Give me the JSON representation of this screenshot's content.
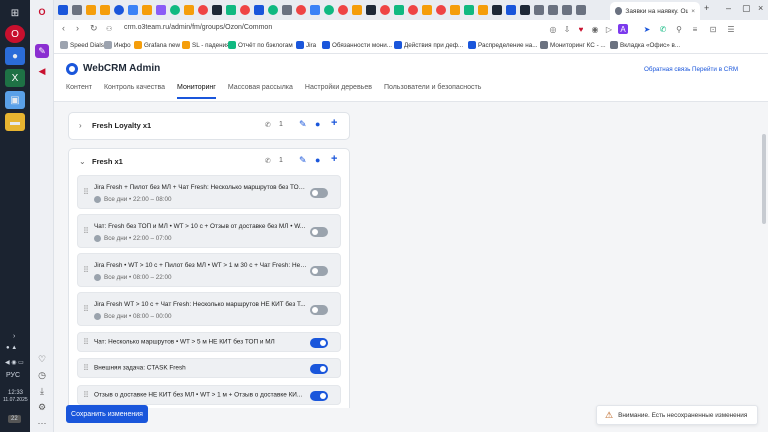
{
  "taskbar": {
    "time": "12:33",
    "date": "11.07.2025",
    "lang": "РУС",
    "notif_count": "22"
  },
  "browser": {
    "active_tab_title": "Заявки на наявку. Ошибк",
    "url": "crm.o3team.ru/admin/fm/groups/Ozon/Common",
    "bookmarks": [
      "Speed Dials",
      "Инфо",
      "Grafana new",
      "SL - падения",
      "Отчёт по бэклогам",
      "Jira",
      "Обязанности мони...",
      "Действия при деф...",
      "Распределение на...",
      "Мониторинг КС - ...",
      "Вкладка «Офис» в..."
    ]
  },
  "header": {
    "brand": "WebCRM Admin",
    "feedback_link": "Обратная связь",
    "crm_link": "Перейти в CRM"
  },
  "nav": [
    "Контент",
    "Контроль качества",
    "Мониторинг",
    "Массовая рассылка",
    "Настройки деревьев",
    "Пользователи и безопасность"
  ],
  "groups": [
    {
      "title": "Fresh Loyalty x1",
      "count": "1"
    },
    {
      "title": "Fresh x1",
      "count": "1"
    }
  ],
  "rules": [
    {
      "title": "Jira Fresh + Пилот без МЛ + Чат Fresh: Несколько маршрутов без ТОП...",
      "schedule": "Все дни • 22:00 – 08:00",
      "enabled": false
    },
    {
      "title": "Чат: Fresh без ТОП и МЛ • WT > 10 с + Отзыв от доставке без МЛ • W...",
      "schedule": "Все дни • 22:00 – 07:00",
      "enabled": false
    },
    {
      "title": "Jira Fresh • WT > 10 с + Пилот без МЛ • WT > 1 м 30 с + Чат Fresh: Нес...",
      "schedule": "Все дни • 08:00 – 22:00",
      "enabled": false
    },
    {
      "title": "Jira Fresh WT > 10 с + Чат Fresh: Несколько маршрутов НЕ КИТ без Т...",
      "schedule": "Все дни • 08:00 – 00:00",
      "enabled": false
    },
    {
      "title": "Чат: Несколько маршрутов • WT > 5 м НЕ КИТ без ТОП и МЛ",
      "enabled": true
    },
    {
      "title": "Внешняя задача: CTASK Fresh",
      "enabled": true
    },
    {
      "title": "Отзыв о доставке НЕ КИТ без МЛ • WT > 1 м + Отзыв о доставке КИ...",
      "enabled": true
    }
  ],
  "footer": {
    "save_label": "Сохранить изменения",
    "warning": "Внимание. Есть несохраненные изменения"
  },
  "colors": {
    "accent": "#1a56db",
    "toggle_off": "#9aa3ad"
  }
}
